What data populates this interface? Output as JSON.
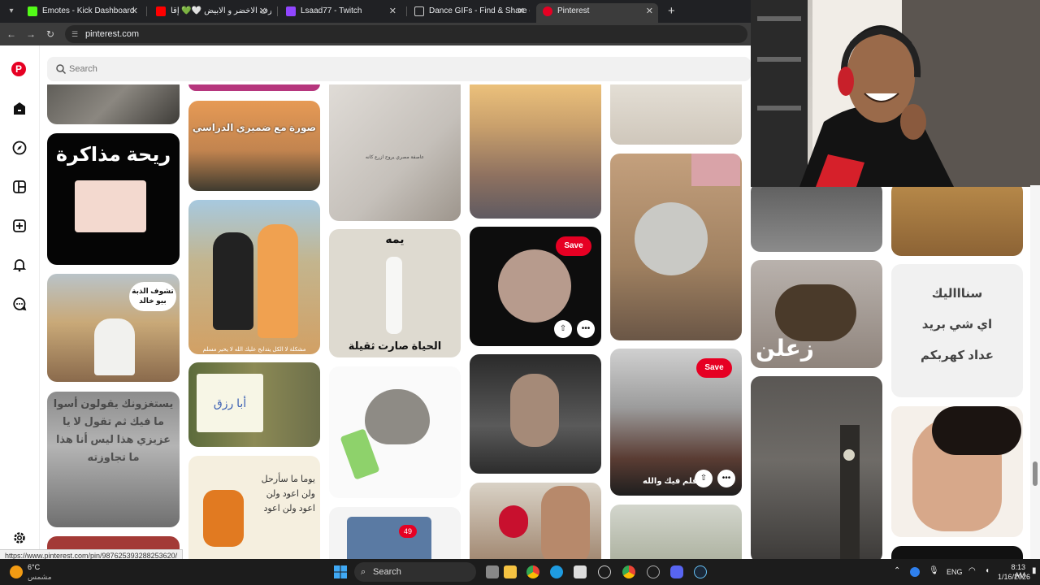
{
  "browser": {
    "tabs": [
      {
        "title": "Emotes - Kick Dashboard",
        "color": "#53fc18"
      },
      {
        "title": "رفرف الاخضر و الابيض 🤍💚 إقا",
        "color": "#ff0000"
      },
      {
        "title": "Lsaad77 - Twitch",
        "color": "#9146ff"
      },
      {
        "title": "Dance GIFs - Find & Share on G",
        "color": "#cccccc"
      },
      {
        "title": "Pinterest",
        "color": "#e60023",
        "active": true
      }
    ],
    "url": "pinterest.com",
    "status_url": "https://www.pinterest.com/pin/987625393288253620/"
  },
  "pinterest": {
    "logo_letter": "P",
    "search_placeholder": "Search",
    "sidebar_icons": [
      "home-icon",
      "explore-icon",
      "boards-icon",
      "create-icon",
      "notifications-icon",
      "messages-icon",
      "settings-icon"
    ],
    "save_label": "Save",
    "pins": {
      "p2": "ريحة مذاكرة",
      "p3": "تشوف الذبة بيو خالد",
      "p4": "يستغزونك يقولون أسوا ما فيك ثم تقول لا يا عزيزي هذا ليس أنا هذا ما تجاوزته",
      "p6": "صورة مع ضميري الدراسي",
      "p7": "مشكلة لا الكل يتدابح عليك الله لا يحير مسلم",
      "p8": "أبا رزق",
      "p9": "يوما ما سأرحل ولن اعود ولن اعود ولن اعود",
      "p10": "عاصفة مصري يروح ازرع كانه",
      "p11_top": "يمه",
      "p11_bottom": "الحياة صارت ثقيلة",
      "p13": "49",
      "p19": "ي اقلم فيك والله",
      "p21": "زعلن",
      "p23_lines": [
        "سناااليك",
        "اي شي بريد",
        "عداد كهربكم"
      ]
    }
  },
  "taskbar": {
    "weather_temp": "6°C",
    "weather_desc": "مشمس",
    "search_label": "Search",
    "language": "ENG",
    "time": "8:13 AM",
    "date": "1/16/2026"
  }
}
